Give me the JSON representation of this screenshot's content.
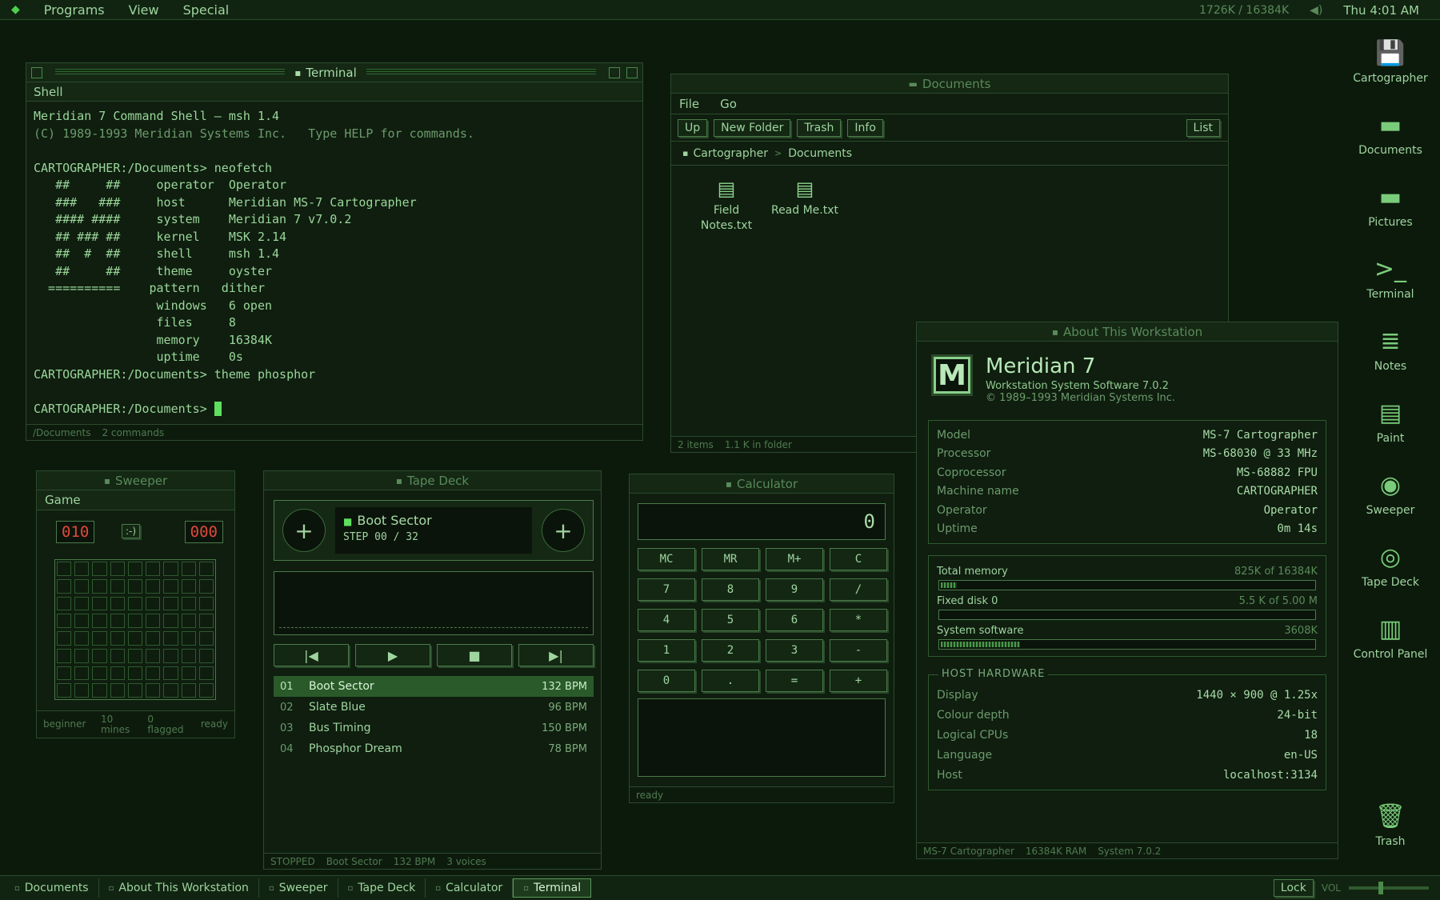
{
  "menubar": {
    "logo": "◆",
    "items": [
      "Programs",
      "View",
      "Special"
    ],
    "memory": "1726K / 16384K",
    "speaker": "◀)",
    "clock": "Thu 4:01 AM"
  },
  "terminal": {
    "title": "Terminal",
    "menu": "Shell",
    "lines": [
      "Meridian 7 Command Shell — msh 1.4",
      "(C) 1989-1993 Meridian Systems Inc.   Type HELP for commands.",
      "",
      "CARTOGRAPHER:/Documents> neofetch",
      "   ##     ##     operator  Operator",
      "   ###   ###     host      Meridian MS-7 Cartographer",
      "   #### ####     system    Meridian 7 v7.0.2",
      "   ## ### ##     kernel    MSK 2.14",
      "   ##  #  ##     shell     msh 1.4",
      "   ##     ##     theme     oyster",
      "  ==========    pattern   dither",
      "                 windows   6 open",
      "                 files     8",
      "                 memory    16384K",
      "                 uptime    0s",
      "CARTOGRAPHER:/Documents> theme phosphor",
      ""
    ],
    "prompt": "CARTOGRAPHER:/Documents> ",
    "status_path": "/Documents",
    "status_count": "2 commands"
  },
  "documents": {
    "title": "Documents",
    "menu": [
      "File",
      "Go"
    ],
    "toolbar": [
      "Up",
      "New Folder",
      "Trash",
      "Info"
    ],
    "view_button": "List",
    "breadcrumb": [
      "Cartographer",
      "Documents"
    ],
    "files": [
      "Field Notes.txt",
      "Read Me.txt"
    ],
    "status_items": "2 items",
    "status_size": "1.1 K in folder"
  },
  "about": {
    "title": "About This Workstation",
    "logo_letter": "M",
    "product": "Meridian 7",
    "subtitle": "Workstation System Software 7.0.2",
    "copyright": "© 1989–1993 Meridian Systems Inc.",
    "specs": [
      {
        "k": "Model",
        "v": "MS-7 Cartographer"
      },
      {
        "k": "Processor",
        "v": "MS-68030 @ 33 MHz"
      },
      {
        "k": "Coprocessor",
        "v": "MS-68882 FPU"
      },
      {
        "k": "Machine name",
        "v": "CARTOGRAPHER"
      },
      {
        "k": "Operator",
        "v": "Operator"
      },
      {
        "k": "Uptime",
        "v": "0m 14s"
      }
    ],
    "meters": [
      {
        "label": "Total memory",
        "value": "825K of 16384K",
        "fraction": 0.05
      },
      {
        "label": "Fixed disk 0",
        "value": "5.5 K of 5.00 M",
        "fraction": 0.0
      },
      {
        "label": "System software",
        "value": "3608K",
        "fraction": 0.22
      }
    ],
    "host_title": "HOST HARDWARE",
    "host": [
      {
        "k": "Display",
        "v": "1440 × 900 @ 1.25x"
      },
      {
        "k": "Colour depth",
        "v": "24-bit"
      },
      {
        "k": "Logical CPUs",
        "v": "18"
      },
      {
        "k": "Language",
        "v": "en-US"
      },
      {
        "k": "Host",
        "v": "localhost:3134"
      }
    ],
    "status": [
      "MS-7 Cartographer",
      "16384K RAM",
      "System 7.0.2"
    ]
  },
  "sweeper": {
    "title": "Sweeper",
    "menu": "Game",
    "mines_lcd": "010",
    "face": ":-)",
    "time_lcd": "000",
    "status": [
      "beginner",
      "10 mines",
      "0 flagged",
      "ready"
    ]
  },
  "tapedeck": {
    "title": "Tape Deck",
    "reel_left": "+",
    "reel_right": "+",
    "now_playing": "Boot Sector",
    "step": "STEP 00 / 32",
    "transport": [
      "|◀",
      "▶",
      "■",
      "▶|"
    ],
    "tracks": [
      {
        "n": "01",
        "name": "Boot Sector",
        "bpm": "132 BPM"
      },
      {
        "n": "02",
        "name": "Slate Blue",
        "bpm": "96 BPM"
      },
      {
        "n": "03",
        "name": "Bus Timing",
        "bpm": "150 BPM"
      },
      {
        "n": "04",
        "name": "Phosphor Dream",
        "bpm": "78 BPM"
      }
    ],
    "status": [
      "STOPPED",
      "Boot Sector",
      "132 BPM",
      "3 voices"
    ]
  },
  "calculator": {
    "title": "Calculator",
    "display": "0",
    "keys": [
      "MC",
      "MR",
      "M+",
      "C",
      "7",
      "8",
      "9",
      "/",
      "4",
      "5",
      "6",
      "*",
      "1",
      "2",
      "3",
      "-",
      "0",
      ".",
      "=",
      "+"
    ],
    "status": "ready"
  },
  "desktop_icons": [
    {
      "label": "Cartographer",
      "icon": "floppy-icon",
      "glyph": "💾"
    },
    {
      "label": "Documents",
      "icon": "folder-icon",
      "glyph": "▬"
    },
    {
      "label": "Pictures",
      "icon": "folder-icon",
      "glyph": "▬"
    },
    {
      "label": "Terminal",
      "icon": "terminal-icon",
      "glyph": ">_"
    },
    {
      "label": "Notes",
      "icon": "notes-icon",
      "glyph": "≣"
    },
    {
      "label": "Paint",
      "icon": "paint-icon",
      "glyph": "▤"
    },
    {
      "label": "Sweeper",
      "icon": "sweeper-icon",
      "glyph": "◉"
    },
    {
      "label": "Tape Deck",
      "icon": "tape-icon",
      "glyph": "◎"
    },
    {
      "label": "Control Panel",
      "icon": "sliders-icon",
      "glyph": "▥"
    },
    {
      "label": "Trash",
      "icon": "trash-icon",
      "glyph": "🗑"
    }
  ],
  "taskbar": {
    "tasks": [
      "Documents",
      "About This Workstation",
      "Sweeper",
      "Tape Deck",
      "Calculator",
      "Terminal"
    ],
    "active": "Terminal",
    "lock": "Lock",
    "vol": "VOL",
    "volume_level": 0.4
  },
  "colors": {
    "background": "#0c1a0c",
    "accent": "#4ed04e",
    "lcd_red": "#e04a3a",
    "selection": "#2a5a2a"
  }
}
